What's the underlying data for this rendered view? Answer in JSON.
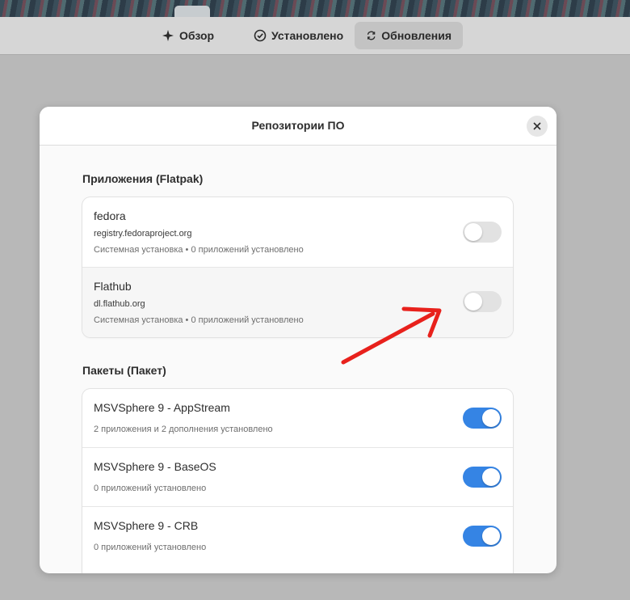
{
  "nav": {
    "tabs": [
      {
        "label": "Обзор",
        "icon": "explore-icon"
      },
      {
        "label": "Установлено",
        "icon": "check-circle-icon"
      },
      {
        "label": "Обновления",
        "icon": "refresh-icon"
      }
    ],
    "active": "Обновления"
  },
  "dialog": {
    "title": "Репозитории ПО",
    "flatpak_section": {
      "title": "Приложения (Flatpak)",
      "items": [
        {
          "name": "fedora",
          "url": "registry.fedoraproject.org",
          "info": "Системная установка • 0 приложений установлено",
          "enabled": false
        },
        {
          "name": "Flathub",
          "url": "dl.flathub.org",
          "info": "Системная установка • 0 приложений установлено",
          "enabled": false
        }
      ]
    },
    "packages_section": {
      "title": "Пакеты (Пакет)",
      "items": [
        {
          "name": "MSVSphere 9 - AppStream",
          "info": "2 приложения и 2 дополнения установлено",
          "enabled": true
        },
        {
          "name": "MSVSphere 9 - BaseOS",
          "info": "0 приложений установлено",
          "enabled": true
        },
        {
          "name": "MSVSphere 9 - CRB",
          "info": "0 приложений установлено",
          "enabled": true
        }
      ]
    }
  },
  "colors": {
    "accent": "#3584e4",
    "annotation_arrow": "#e8211c"
  }
}
